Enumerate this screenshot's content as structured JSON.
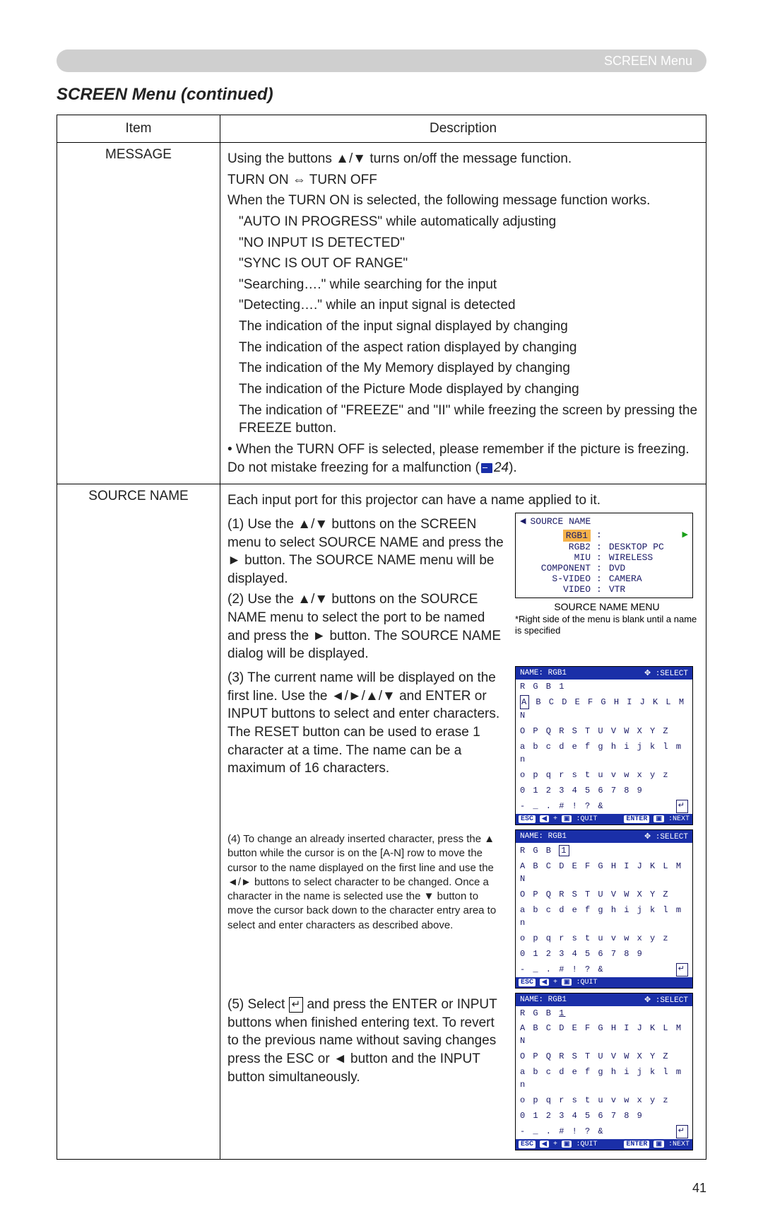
{
  "header": {
    "breadcrumb": "SCREEN Menu"
  },
  "section_title": "SCREEN Menu (continued)",
  "table": {
    "headers": {
      "item": "Item",
      "description": "Description"
    },
    "rows": {
      "message": {
        "item": "MESSAGE",
        "intro": "Using the buttons ▲/▼ turns on/off the message function.",
        "toggle": {
          "on": "TURN ON",
          "sep": "⇔",
          "off": "TURN OFF"
        },
        "when_on": "When the TURN ON is selected, the following message function works.",
        "bullets": [
          "\"AUTO IN PROGRESS\" while automatically adjusting",
          "\"NO INPUT IS DETECTED\"",
          "\"SYNC IS OUT OF RANGE\"",
          "\"Searching….\" while searching for the input",
          "\"Detecting….\" while an input signal is detected",
          "The indication of the input signal displayed by changing",
          "The indication of the aspect ration displayed by changing",
          "The indication of the My Memory displayed by changing",
          "The indication of the Picture Mode displayed by changing",
          "The indication of \"FREEZE\" and \"II\" while freezing the screen by pressing the FREEZE button."
        ],
        "when_off": "• When the TURN OFF is selected, please remember if the picture is freezing. Do not mistake freezing for a malfunction (",
        "ref_page": "24",
        "when_off_end": ")."
      },
      "source_name": {
        "item": "SOURCE NAME",
        "p0": "Each input port for this projector can have a name applied to it.",
        "p1": "(1) Use the ▲/▼ buttons on the SCREEN menu to select SOURCE NAME and press the ► button. The SOURCE NAME menu will be displayed.",
        "p2": "(2) Use the ▲/▼ buttons on the SOURCE NAME menu to select the port to be named and press the ► button. The SOURCE NAME dialog will be displayed.",
        "p3": "(3) The current name will be displayed on the first line. Use the ◄/►/▲/▼ and ENTER or INPUT buttons to select and enter characters. The RESET button can be used to erase 1 character at a time. The name can be a maximum of 16 characters.",
        "p4": "(4) To change an already inserted character, press the ▲ button while the cursor is on the [A-N] row to move the cursor to the name displayed on the first line and use the ◄/► buttons to select character to be changed. Once a character in the name is selected use the ▼ button to move the cursor back down to the character entry area to select and enter characters as described above.",
        "p5a": "(5) Select ",
        "p5b": " and press the ENTER or INPUT buttons when finished entering text. To revert to the previous name without saving changes press the ESC or ◄ button and the INPUT button simultaneously."
      }
    }
  },
  "osd_source_menu": {
    "title": "SOURCE NAME",
    "selected": "RGB1",
    "items": [
      {
        "port": "RGB2",
        "name": "DESKTOP PC"
      },
      {
        "port": "MIU",
        "name": "WIRELESS"
      },
      {
        "port": "COMPONENT",
        "name": "DVD"
      },
      {
        "port": "S-VIDEO",
        "name": "CAMERA"
      },
      {
        "port": "VIDEO",
        "name": "VTR"
      }
    ],
    "caption": "SOURCE NAME MENU",
    "note": "*Right side of the menu is blank until a name is specified"
  },
  "kb_common": {
    "name_label": "NAME:",
    "name_value": "RGB1",
    "select_label": ":SELECT",
    "current": "R G B 1",
    "alpha_upper1": "A B C D E F G H I J K L M N",
    "alpha_upper2": "O P Q R S T U V W X Y Z",
    "alpha_lower1": "a b c d e f g h i j k l m n",
    "alpha_lower2": "o p q r s t u v w x y z",
    "digits": "0 1 2 3 4 5 6 7 8 9",
    "symbols": "- _ . # ! ? &",
    "esc": "ESC",
    "quit": ":QUIT",
    "enter": "ENTER",
    "next": ":NEXT"
  },
  "kb1": {
    "highlight_first_A": true,
    "show_next": true,
    "name_plain": "R G B 1"
  },
  "kb2": {
    "highlight_name_1": true,
    "show_next": false,
    "name_prefix": "R G B "
  },
  "kb3": {
    "underline_name_1": true,
    "show_next": true,
    "name_plain": "R G B 1"
  },
  "page_number": "41"
}
